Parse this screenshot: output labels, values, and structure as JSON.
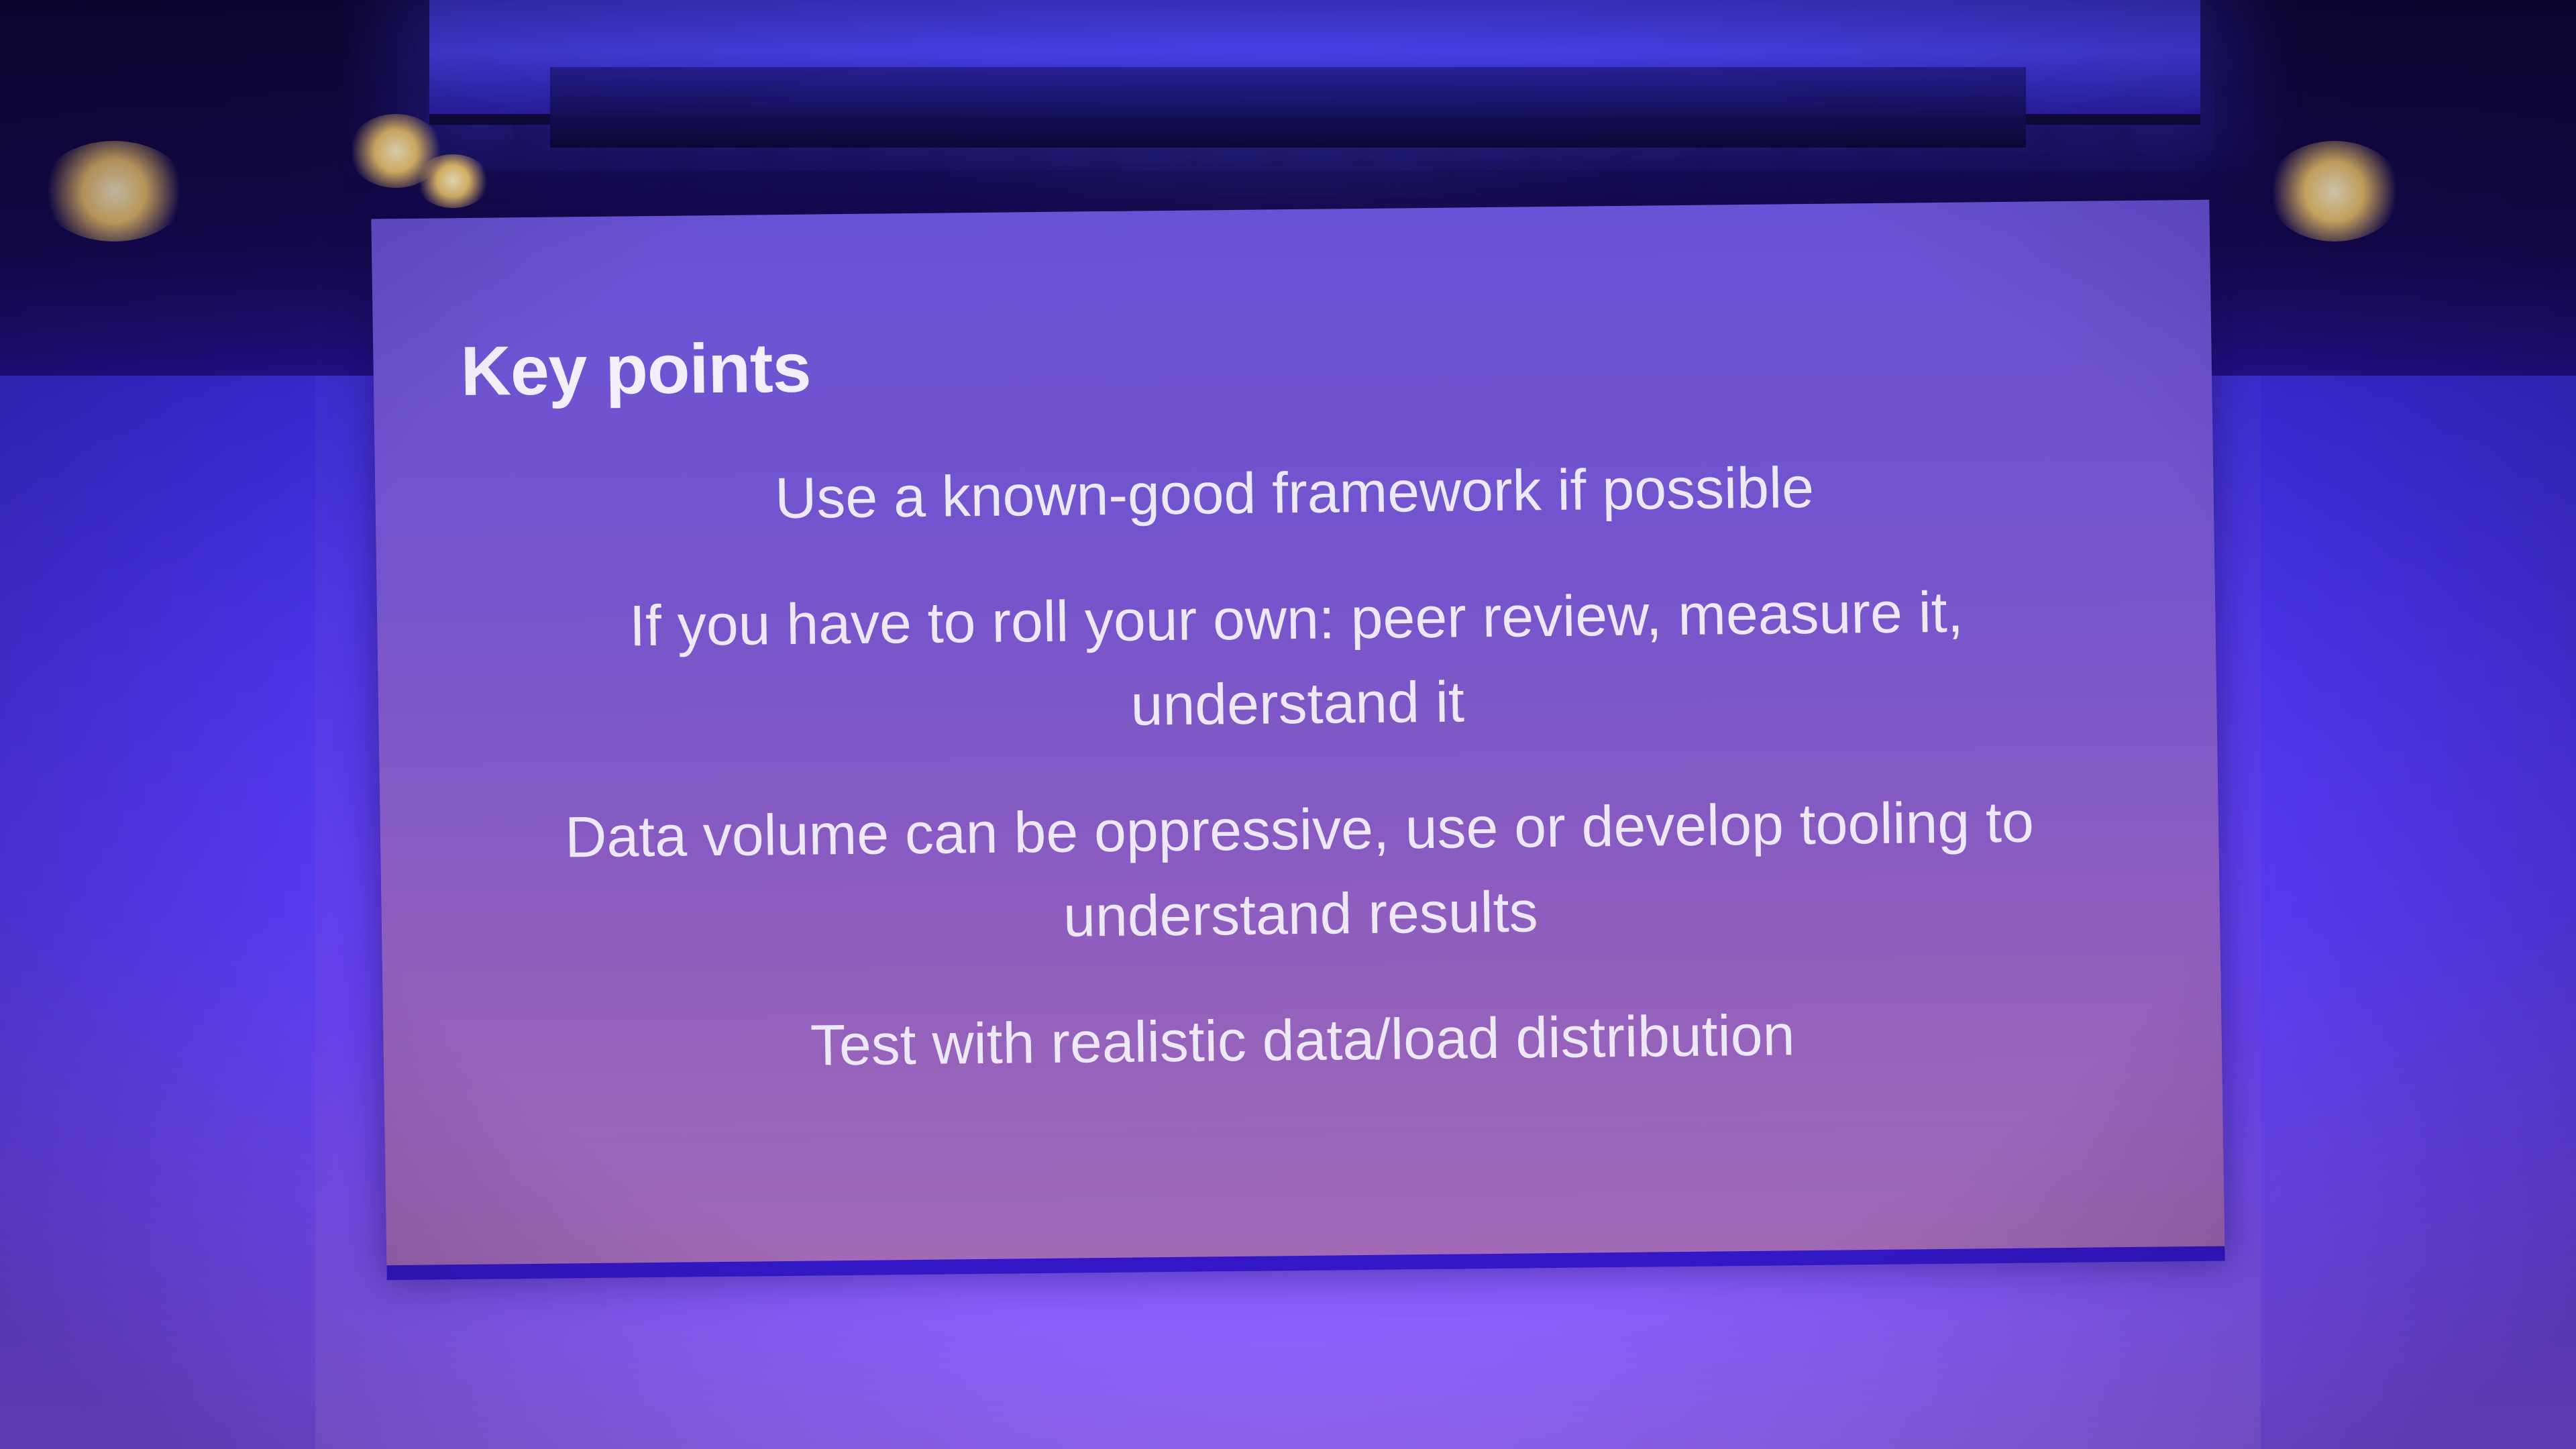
{
  "slide": {
    "title": "Key points",
    "points": [
      "Use a known-good framework if possible",
      "If you have to roll your own: peer review, measure it, understand it",
      "Data volume can be oppressive, use or develop tooling to understand results",
      "Test with realistic data/load distribution"
    ]
  },
  "colors": {
    "stage_light": "#5a3cf6",
    "slide_background": "#7454cc",
    "slide_text": "#ece8f8"
  }
}
